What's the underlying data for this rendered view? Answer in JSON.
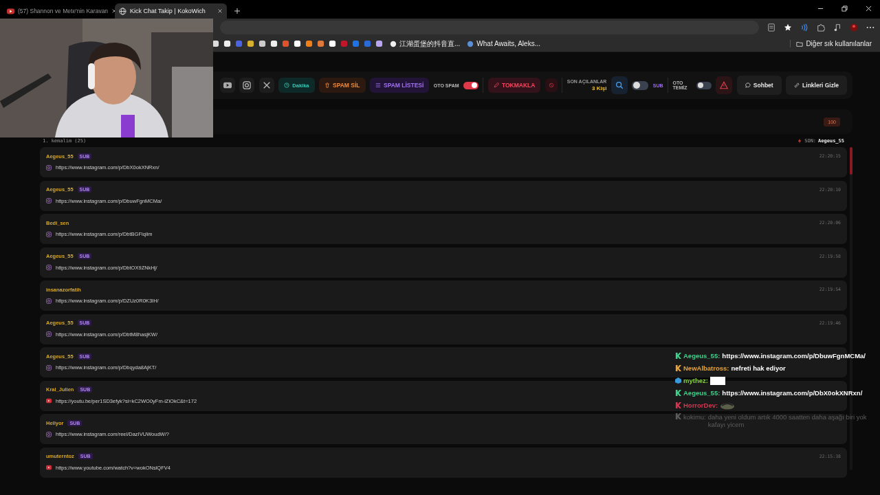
{
  "browser": {
    "tabs": [
      {
        "title": "(57) Shannon ve Mete'nin Karavan",
        "selected": false
      },
      {
        "title": "Kick Chat Takip | KokoWich",
        "selected": true
      }
    ],
    "bookmarks": [
      "江湖蛋堡的抖音直...",
      "What Awaits, Aleks..."
    ],
    "other_bookmarks": "Diğer sık kullanılanlar"
  },
  "toolbar": {
    "dakika": "Dakika",
    "spam_sil": "SPAM SİL",
    "spam_listesi": "SPAM LİSTESİ",
    "oto_spam": {
      "label": "OTO SPAM",
      "on": true
    },
    "tokmakla": "TOKMAKLA",
    "son_acilanlar": {
      "label": "SON AÇILANLAR",
      "value": "3 Kişi"
    },
    "sub_toggle": {
      "label": "SUB",
      "on": false
    },
    "oto_temiz": {
      "label": "OTO TEMİZ",
      "on": false
    },
    "sohbet": "Sohbet",
    "linkleri_gizle": "Linkleri Gizle"
  },
  "counter": "100",
  "leader": "1. kemalim (25)",
  "last": {
    "label": "SON:",
    "user": "Aegeus_55"
  },
  "messages": [
    {
      "user": "Aegeus_55",
      "badge": "SUB",
      "kind": "instagram",
      "url": "https://www.instagram.com/p/DbX0okXNRxn/",
      "time": "22:20:15"
    },
    {
      "user": "Aegeus_55",
      "badge": "SUB",
      "kind": "instagram",
      "url": "https://www.instagram.com/p/DbuwFgnMCMa/",
      "time": "22:20:10"
    },
    {
      "user": "Bedi_sen",
      "kind": "instagram",
      "url": "https://www.instagram.com/p/DbtBGFiqiim",
      "time": "22:20:06"
    },
    {
      "user": "Aegeus_55",
      "badge": "SUB",
      "kind": "instagram",
      "url": "https://www.instagram.com/p/DbtOX9ZNkHj/",
      "time": "22:19:58"
    },
    {
      "user": "insanazorfatih",
      "kind": "instagram",
      "url": "https://www.instagram.com/p/DZUz0R0K3IH/",
      "time": "22:19:54"
    },
    {
      "user": "Aegeus_55",
      "badge": "SUB",
      "kind": "instagram",
      "url": "https://www.instagram.com/p/DbtM8hasjKW/",
      "time": "22:19:46"
    },
    {
      "user": "Aegeus_55",
      "badge": "SUB",
      "kind": "instagram",
      "url": "https://www.instagram.com/p/Dbqyda8AjKT/"
    },
    {
      "user": "Kral_Julien",
      "badge": "SUB",
      "kind": "youtube",
      "url": "https://youtu.be/per1SD3efyk?si=kC2WO0yFm-iZiOkC&t=172"
    },
    {
      "user": "Hellyor",
      "badge": "SUB",
      "kind": "instagram",
      "url": "https://www.instagram.com/reel/DazIVUWoudW/?"
    },
    {
      "user": "umuterntoz",
      "badge": "SUB",
      "kind": "youtube",
      "url": "https://www.youtube.com/watch?v=wokONslQFV4",
      "time": "22:15:38"
    }
  ],
  "overlay_chat": [
    {
      "kind": "text",
      "user": "Aegeus_55:",
      "color": "#3fd08a",
      "text": "https://www.instagram.com/p/DbuwFgnMCMa/"
    },
    {
      "kind": "text",
      "user": "NewAlbatross:",
      "color": "#e8a33a",
      "text": "nefreti hak ediyor"
    },
    {
      "kind": "square",
      "user": "mythez:",
      "color": "#86d43b"
    },
    {
      "kind": "text",
      "user": "Aegeus_55:",
      "color": "#3fd08a",
      "text": "https://www.instagram.com/p/DbX0okXNRxn/"
    },
    {
      "user": "HorrorDev:",
      "color": "#d8344f"
    },
    {
      "kind": "faded",
      "user": "kokimu:",
      "color": "#5c5c5c",
      "text": "daha yeni oldum artık 4000 saatten daha aşağı biri yok kafayı yicem"
    }
  ]
}
